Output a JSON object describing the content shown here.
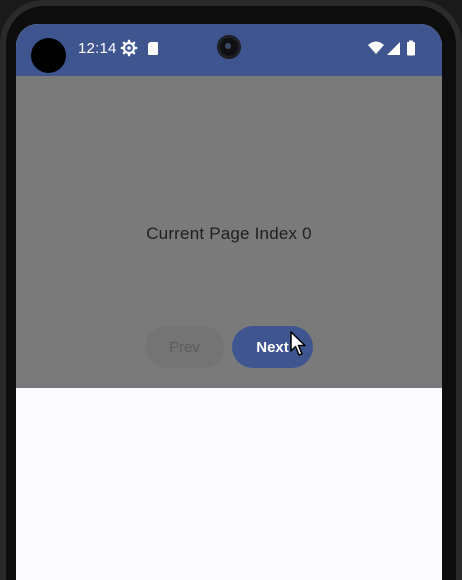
{
  "status_bar": {
    "time": "12:14",
    "icons": [
      "settings-gear-icon",
      "sd-card-icon",
      "wifi-icon",
      "signal-icon",
      "battery-icon"
    ],
    "background": "#3f5590"
  },
  "main": {
    "page_label": "Current Page Index 0",
    "prev_label": "Prev",
    "next_label": "Next",
    "overlay_color": "#7a7a7a",
    "accent": "#3f5590",
    "prev_enabled": false
  }
}
